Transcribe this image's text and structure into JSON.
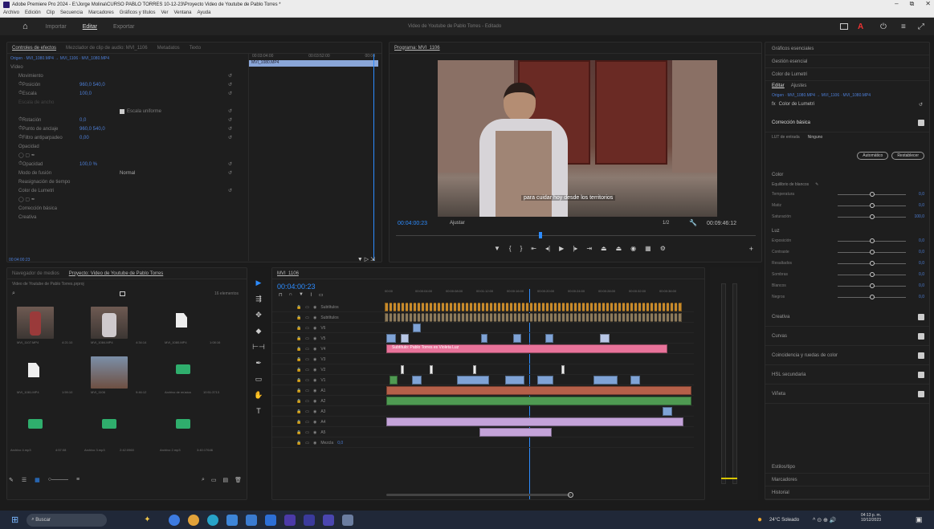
{
  "window": {
    "title": "Adobe Premiere Pro 2024 - E:\\Jorge Molina\\CURSO PABLO TORRES 10-12-23\\Proyecto Video de Youtube de Pablo Torres *",
    "controls": [
      "–",
      "⧉",
      "✕"
    ]
  },
  "menu": [
    "Archivo",
    "Edición",
    "Clip",
    "Secuencia",
    "Marcadores",
    "Gráficos y títulos",
    "Ver",
    "Ventana",
    "Ayuda"
  ],
  "workspace": {
    "items": [
      "Importar",
      "Editar",
      "Exportar"
    ],
    "active": "Editar",
    "center_title": "Video de Youtube de Pablo Torres - Editado"
  },
  "source_panel": {
    "tabs": [
      "Controles de efectos",
      "Mezclador de clip de audio: MVI_1106",
      "Metadatos",
      "Texto"
    ],
    "source_label": "Origen · MVI_1080.MP4 → MVI_1106 · MVI_1080.MP4",
    "section": "Vídeo",
    "times": [
      "00:03:04:00",
      "00:03:52:00",
      "00:04"
    ],
    "clip_name": "MVI_1080.MP4",
    "rows": [
      {
        "n": "Movimiento",
        "v": ""
      },
      {
        "n": "Posición",
        "v": "960,0   540,0"
      },
      {
        "n": "Escala",
        "v": "100,0"
      },
      {
        "n": "Escala de ancho",
        "v": ""
      },
      {
        "n": "Escala uniforme",
        "v": ""
      },
      {
        "n": "Rotación",
        "v": "0,0"
      },
      {
        "n": "Punto de anclaje",
        "v": "960,0   540,0"
      },
      {
        "n": "Filtro antiparpadeo",
        "v": "0,00"
      },
      {
        "n": "Opacidad",
        "v": ""
      },
      {
        "n": "Opacidad",
        "v": "100,0 %"
      },
      {
        "n": "Modo de fusión",
        "v": "Normal"
      },
      {
        "n": "Reasignación de tiempo",
        "v": ""
      },
      {
        "n": "Color de Lumetri",
        "v": ""
      },
      {
        "n": "Corrección básica",
        "v": ""
      },
      {
        "n": "Creativa",
        "v": ""
      }
    ],
    "footer_time": "00:04:00:23"
  },
  "program": {
    "label": "Programa: MVI_1106",
    "timecode": "00:04:00:23",
    "fit": "Ajustar",
    "quality": "1/2",
    "duration": "00:09:46:12",
    "subtitle": "para cuidar hoy desde los territorios"
  },
  "project": {
    "tabs": [
      "Navegador de medios",
      "Proyecto: Video de Youtube de Pablo Torres"
    ],
    "path": "Video de Youtube de Pablo Torres.prproj",
    "count": "16 elementos",
    "items": [
      {
        "name": "MVI_1107.MP4",
        "dur": "4:21:10"
      },
      {
        "name": "MVI_1084.MP4",
        "dur": "4:34:14"
      },
      {
        "name": "MVI_1080.MP4",
        "dur": "1:08:16"
      },
      {
        "name": "MVI_1081.MP4",
        "dur": "1:59:10"
      },
      {
        "name": "MVI_1106",
        "dur": "9:46:12"
      },
      {
        "name": "Archivo de música",
        "dur": "10:51:3713"
      },
      {
        "name": "Archivo 4.mp3",
        "dur": "4:57:08"
      },
      {
        "name": "Archivo 3.mp3",
        "dur": "2:42:0960"
      },
      {
        "name": "Archivo 2.mp3",
        "dur": "3:40:17646"
      }
    ]
  },
  "timeline": {
    "tab": "MVI_1106",
    "timecode": "00:04:00:23",
    "ruler": [
      "00:00",
      "00:00:04:00",
      "00:00:08:00",
      "00:01:12:00",
      "00:00:16:00",
      "00:00:20:00",
      "00:00:24:00",
      "00:00:28:00",
      "00:00:32:00",
      "00:00:36:00"
    ],
    "pink_clip": "Subtítulo: Pablo Torres es Violeta Luz",
    "tracks": [
      "Subtítulos",
      "Subtítulos",
      "V6",
      "V5",
      "V4",
      "V3",
      "V2",
      "V1",
      "A1",
      "A2",
      "A3",
      "A4",
      "A5",
      "Mezcla"
    ],
    "mix_value": "0,0"
  },
  "lumetri": {
    "title": "Gráficos esenciales",
    "sections_top": [
      "Gestión esencial",
      "Color de Lumetri"
    ],
    "tabs": [
      "Editar",
      "Ajustes"
    ],
    "source": "Origen · MVI_1080.MP4 → MVI_1106 · MVI_1080.MP4",
    "effect": "Color de Lumetri",
    "basic": "Corrección básica",
    "lut_label": "LUT de entrada",
    "lut_value": "Ninguno",
    "auto_btn": "Automático",
    "reset_btn": "Restablecer",
    "color_label": "Color",
    "wb_label": "Equilibrio de blancos",
    "sliders_color": [
      {
        "n": "Temperatura",
        "v": "0,0"
      },
      {
        "n": "Matiz",
        "v": "0,0"
      },
      {
        "n": "Saturación",
        "v": "100,0"
      }
    ],
    "luz_label": "Luz",
    "sliders_luz": [
      {
        "n": "Exposición",
        "v": "0,0"
      },
      {
        "n": "Contraste",
        "v": "0,0"
      },
      {
        "n": "Resaltados",
        "v": "0,0"
      },
      {
        "n": "Sombras",
        "v": "0,0"
      },
      {
        "n": "Blancos",
        "v": "0,0"
      },
      {
        "n": "Negros",
        "v": "0,0"
      }
    ],
    "sections": [
      "Creativa",
      "Curvas",
      "Coincidencia y ruedas de color",
      "HSL secundaria",
      "Viñeta"
    ],
    "bottom": [
      "Estilos/tipo",
      "Marcadores",
      "Historial"
    ]
  },
  "taskbar": {
    "search": "Buscar",
    "weather": "24°C Soleado",
    "time": "04:13 p. m.",
    "date": "10/12/2023"
  },
  "colors": {
    "accent": "#2d8cff",
    "pink": "#e8739a",
    "orange": "#c88a2a",
    "green": "#4f9a52",
    "teal": "#3fbf8f",
    "lavender": "#c4a3d9"
  }
}
